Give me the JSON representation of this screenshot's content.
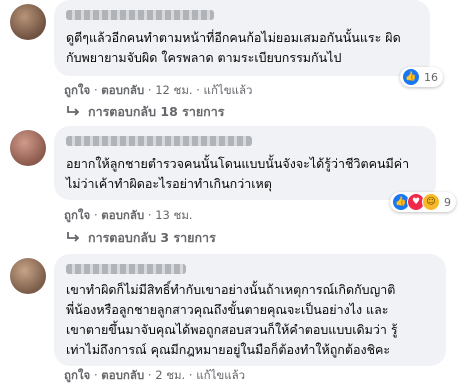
{
  "comments": [
    {
      "lines": [
        "ดูตีๆแล้วอีกคนทำตามหน้าที่อีกคนก้อไม่ยอมเสมอกันนั้นแระ ผิด",
        "กับพยายามจับผิด ใครพลาด ตามระเบียบกรรมกันไป"
      ],
      "reaction_count": "16",
      "actions": {
        "like": "ถูกใจ",
        "reply": "ตอบกลับ",
        "time": "12 ชม.",
        "edited": "แก้ไขแล้ว"
      },
      "replies_label": "การตอบกลับ 18 รายการ"
    },
    {
      "lines": [
        "อยากให้ลูกชายตำรวจคนนั้นโดนแบบนั้นจังจะได้รู้ว่าชีวิตคนมีค่า",
        "ไม่ว่าเค้าทำผิดอะไรอย่าทำเกินกว่าเหตุ"
      ],
      "reaction_count": "9",
      "actions": {
        "like": "ถูกใจ",
        "reply": "ตอบกลับ",
        "time": "13 ชม."
      },
      "replies_label": "การตอบกลับ 3 รายการ"
    },
    {
      "lines": [
        "เขาทำผิดก็ไม่มีสิทธิ์ทำกับเขาอย่างนั้นถ้าเหตุการณ์เกิดกับญาติ",
        "พี่น้องหรือลูกชายลูกสาวคุณถึงขั้นตายคุณจะเป็นอย่างไง และ",
        "เขาตายขึ้นมาจับคุณได้พอถูกสอบสวนก็ให้คำตอบแบบเดิมว่า รู้",
        "เท่าไม่ถึงการณ์ คุณมีกฎหมายอยู่ในมือก็ต้องทำให้ถูกต้องชิคะ"
      ],
      "actions": {
        "like": "ถูกใจ",
        "reply": "ตอบกลับ",
        "time": "2 ชม.",
        "edited": "แก้ไขแล้ว"
      }
    }
  ],
  "colors": {
    "like": "#1877f2",
    "love": "#f02849",
    "haha": "#f7b928"
  }
}
